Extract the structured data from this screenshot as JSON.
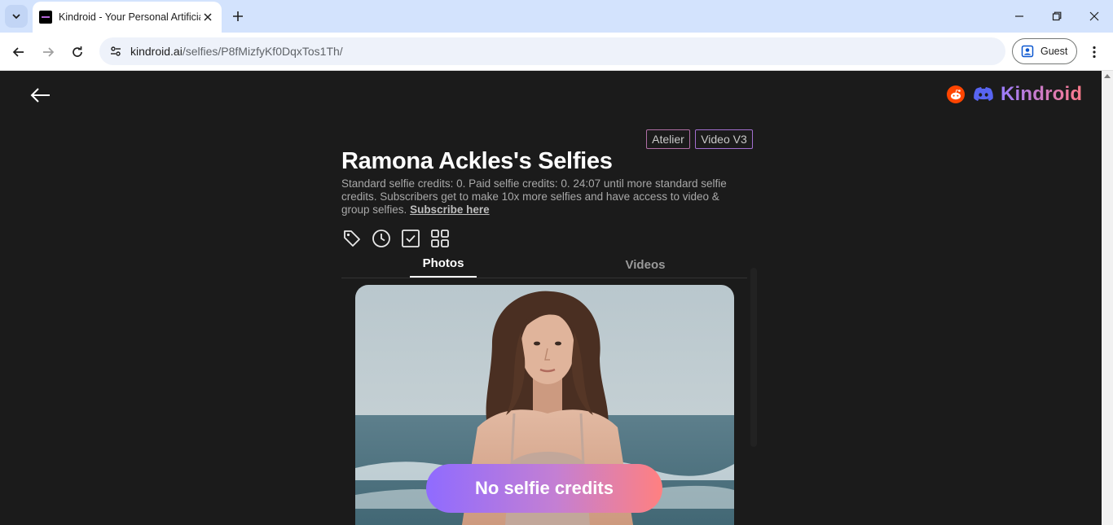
{
  "browser": {
    "tab_title": "Kindroid - Your Personal Artificial",
    "url_host": "kindroid.ai",
    "url_path": "/selfies/P8fMizfyKf0DqxTos1Th/",
    "profile_label": "Guest"
  },
  "header": {
    "brand": "Kindroid",
    "icons": [
      "back-arrow-icon",
      "reddit-icon",
      "discord-icon"
    ]
  },
  "badges": {
    "atelier": "Atelier",
    "video": "Video V3"
  },
  "main": {
    "title": "Ramona Ackles's Selfies",
    "description": "Standard selfie credits: 0. Paid selfie credits: 0. 24:07 until more standard selfie credits. Subscribers get to make 10x more selfies and have access to video & group selfies.",
    "subscribe_link": "Subscribe here",
    "tool_icons": [
      "tag-icon",
      "clock-icon",
      "checkbox-icon",
      "grid-icon"
    ],
    "tabs": [
      {
        "label": "Photos",
        "active": true
      },
      {
        "label": "Videos",
        "active": false
      }
    ],
    "cta": "No selfie credits"
  },
  "colors": {
    "page_bg": "#1b1b1b",
    "gradient_start": "#8f6bff",
    "gradient_end": "#ff8080",
    "reddit": "#ff4500",
    "discord": "#5865f2"
  }
}
